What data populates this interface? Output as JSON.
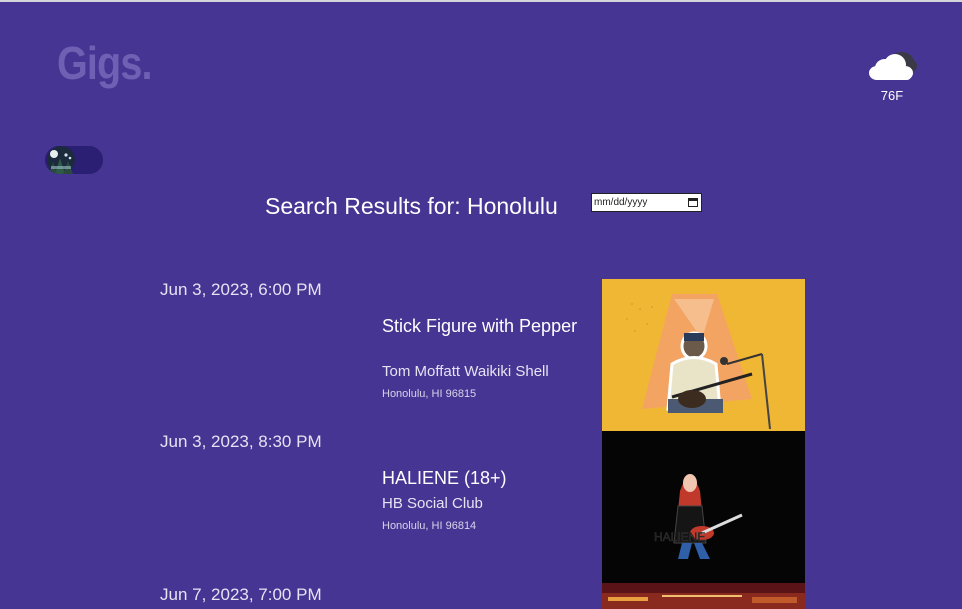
{
  "header": {
    "logo_text": "Gigs.",
    "weather": {
      "icon": "cloud-icon",
      "temperature": "76F"
    },
    "theme_toggle": {
      "icon": "night-scene-icon"
    }
  },
  "search": {
    "heading": "Search Results for: Honolulu",
    "date_placeholder": "mm/dd/yyyy"
  },
  "gigs": [
    {
      "datetime": "Jun 3, 2023, 6:00 PM",
      "title": "Stick Figure with Pepper",
      "venue": "Tom Moffatt Waikiki Shell",
      "address": "Honolulu, HI 96815",
      "image_bg": "#f0b735"
    },
    {
      "datetime": "Jun 3, 2023, 8:30 PM",
      "title": "HALIENE (18+)",
      "venue": "HB Social Club",
      "address": "Honolulu, HI 96814",
      "image_bg": "#050505"
    },
    {
      "datetime": "Jun 7, 2023, 7:00 PM",
      "image_bg": "#5a1418"
    }
  ],
  "colors": {
    "background": "#463593",
    "logo": "#7060b4",
    "text": "#ffffff"
  }
}
